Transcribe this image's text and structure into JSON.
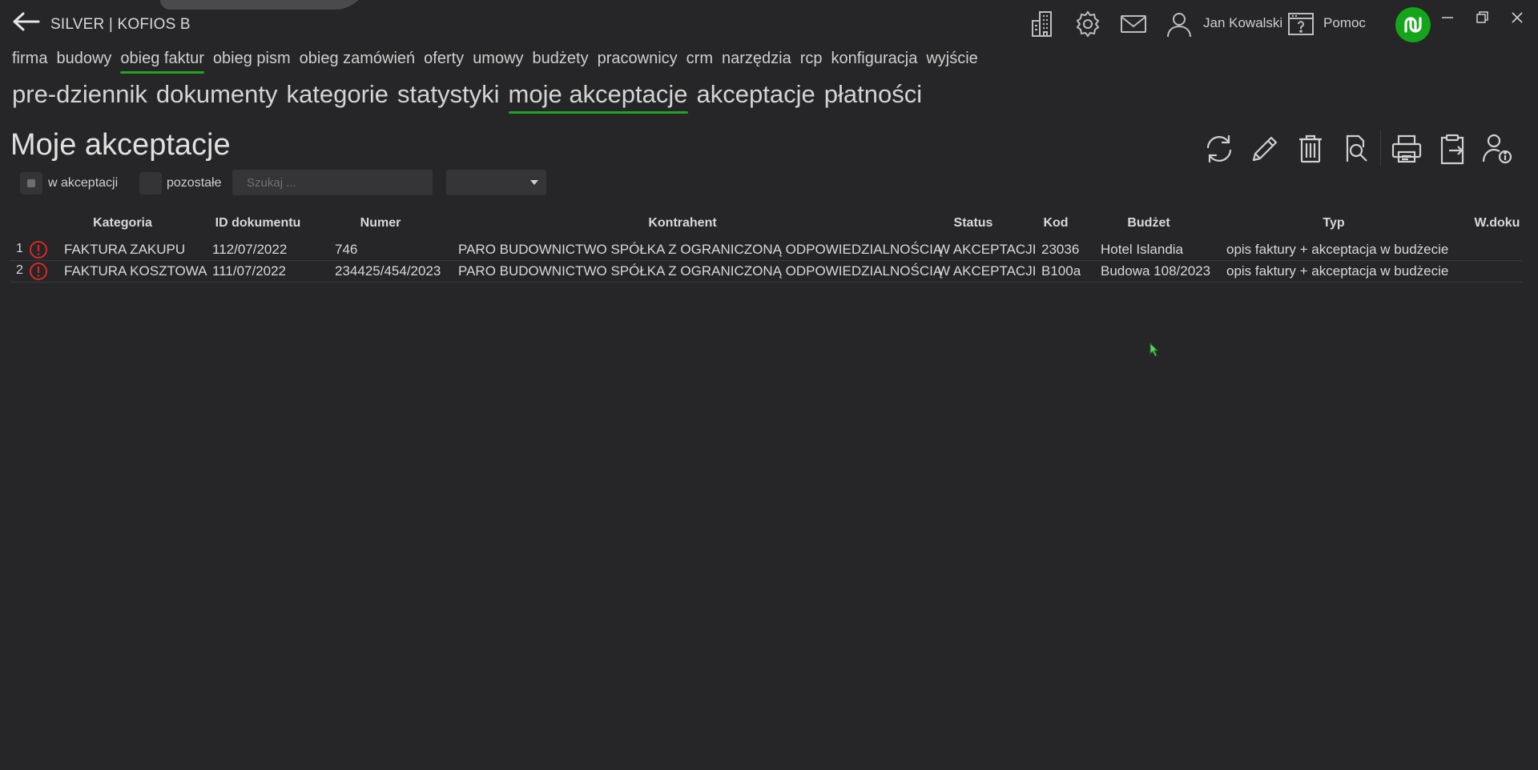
{
  "window": {
    "title": "SILVER | KOFIOS B"
  },
  "header": {
    "user_name": "Jan Kowalski",
    "help_label": "Pomoc"
  },
  "main_menu": [
    {
      "label": "firma"
    },
    {
      "label": "budowy"
    },
    {
      "label": "obieg faktur"
    },
    {
      "label": "obieg pism"
    },
    {
      "label": "obieg zamówień"
    },
    {
      "label": "oferty"
    },
    {
      "label": "umowy"
    },
    {
      "label": "budżety"
    },
    {
      "label": "pracownicy"
    },
    {
      "label": "crm"
    },
    {
      "label": "narzędzia"
    },
    {
      "label": "rcp"
    },
    {
      "label": "konfiguracja"
    },
    {
      "label": "wyjście"
    }
  ],
  "main_menu_active": "obieg faktur",
  "sub_menu": [
    {
      "label": "pre-dziennik"
    },
    {
      "label": "dokumenty"
    },
    {
      "label": "kategorie"
    },
    {
      "label": "statystyki"
    },
    {
      "label": "moje akceptacje"
    },
    {
      "label": "akceptacje"
    },
    {
      "label": "płatności"
    }
  ],
  "sub_menu_active": "moje akceptacje",
  "page": {
    "title": "Moje akceptacje"
  },
  "filters": {
    "in_acceptance_label": "w akceptacji",
    "other_label": "pozostałe",
    "search_placeholder": "Szukaj ...",
    "select_value": ""
  },
  "table": {
    "headers": [
      "Kategoria",
      "ID dokumentu",
      "Numer",
      "Kontrahent",
      "Status",
      "Kod",
      "Budżet",
      "Typ",
      "W.doku"
    ],
    "rows": [
      {
        "num": "1",
        "kategoria": "FAKTURA ZAKUPU",
        "id": "112/07/2022",
        "numer": "746",
        "kontrahent": "PARO BUDOWNICTWO SPÓŁKA Z OGRANICZONĄ ODPOWIEDZIALNOŚCIĄ",
        "status": "W AKCEPTACJI",
        "kod": "23036",
        "budzet": "Hotel Islandia",
        "typ": "opis faktury + akceptacja w budżecie"
      },
      {
        "num": "2",
        "kategoria": "FAKTURA KOSZTOWA",
        "id": "111/07/2022",
        "numer": "234425/454/2023",
        "kontrahent": "PARO BUDOWNICTWO SPÓŁKA Z OGRANICZONĄ ODPOWIEDZIALNOŚCIĄ",
        "status": "W AKCEPTACJI",
        "kod": "B100a",
        "budzet": "Budowa 108/2023",
        "typ": "opis faktury + akceptacja w budżecie"
      }
    ]
  },
  "colors": {
    "accent": "#1fa51f",
    "brand": "#14a51a",
    "warning": "#d42a2a",
    "background": "#262628"
  },
  "icons": [
    "back-arrow-icon",
    "building-icon",
    "gear-icon",
    "mail-icon",
    "user-icon",
    "help-window-icon",
    "refresh-icon",
    "edit-pencil-icon",
    "trash-icon",
    "document-search-icon",
    "printer-icon",
    "clipboard-export-icon",
    "user-info-icon",
    "warning-circle-icon"
  ]
}
